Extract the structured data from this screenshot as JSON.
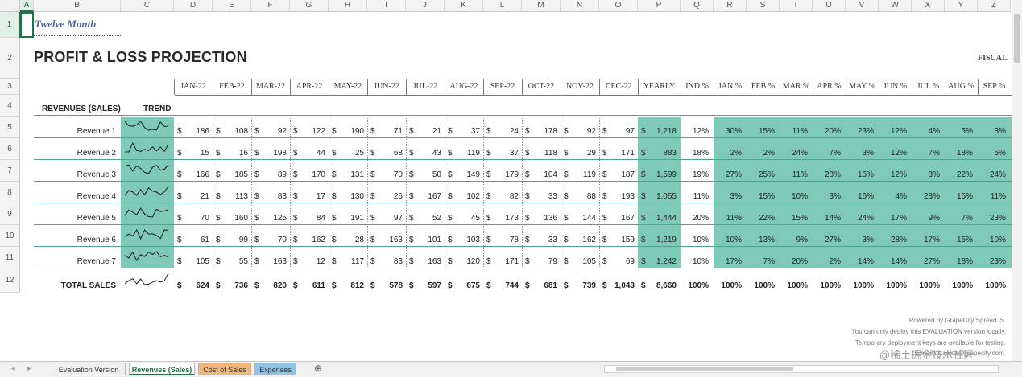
{
  "columns": [
    "A",
    "B",
    "C",
    "D",
    "E",
    "F",
    "G",
    "H",
    "I",
    "J",
    "K",
    "L",
    "M",
    "N",
    "O",
    "P",
    "Q",
    "R",
    "S",
    "T",
    "U",
    "V",
    "W",
    "X",
    "Y",
    "Z"
  ],
  "rows": [
    "1",
    "2",
    "3",
    "4",
    "5",
    "6",
    "7",
    "8",
    "9",
    "10",
    "11",
    "12"
  ],
  "sheet": {
    "title1": "Twelve Month",
    "title2": "PROFIT & LOSS PROJECTION",
    "fiscal": "FISCAL",
    "months": [
      "JAN-22",
      "FEB-22",
      "MAR-22",
      "APR-22",
      "MAY-22",
      "JUN-22",
      "JUL-22",
      "AUG-22",
      "SEP-22",
      "OCT-22",
      "NOV-22",
      "DEC-22"
    ],
    "yearly_label": "YEARLY",
    "pct_labels": [
      "IND %",
      "JAN %",
      "FEB %",
      "MAR %",
      "APR %",
      "MAY %",
      "JUN %",
      "JUL %",
      "AUG %",
      "SEP %"
    ],
    "section_label": "REVENUES (SALES)",
    "trend_label": "TREND",
    "currency": "$",
    "revenues": [
      {
        "name": "Revenue 1",
        "values": [
          "186",
          "108",
          "92",
          "122",
          "190",
          "71",
          "21",
          "37",
          "24",
          "178",
          "92",
          "97"
        ],
        "yearly": "1,218",
        "pcts": [
          "12%",
          "30%",
          "15%",
          "11%",
          "20%",
          "23%",
          "12%",
          "4%",
          "5%",
          "3%"
        ]
      },
      {
        "name": "Revenue 2",
        "values": [
          "15",
          "16",
          "198",
          "44",
          "25",
          "68",
          "43",
          "119",
          "37",
          "118",
          "29",
          "171"
        ],
        "yearly": "883",
        "pcts": [
          "18%",
          "2%",
          "2%",
          "24%",
          "7%",
          "3%",
          "12%",
          "7%",
          "18%",
          "5%"
        ]
      },
      {
        "name": "Revenue 3",
        "values": [
          "166",
          "185",
          "89",
          "170",
          "131",
          "70",
          "50",
          "149",
          "179",
          "104",
          "119",
          "187"
        ],
        "yearly": "1,599",
        "pcts": [
          "19%",
          "27%",
          "25%",
          "11%",
          "28%",
          "16%",
          "12%",
          "8%",
          "22%",
          "24%"
        ]
      },
      {
        "name": "Revenue 4",
        "values": [
          "21",
          "113",
          "83",
          "17",
          "130",
          "26",
          "167",
          "102",
          "82",
          "33",
          "88",
          "193"
        ],
        "yearly": "1,055",
        "pcts": [
          "11%",
          "3%",
          "15%",
          "10%",
          "3%",
          "16%",
          "4%",
          "28%",
          "15%",
          "11%"
        ]
      },
      {
        "name": "Revenue 5",
        "values": [
          "70",
          "160",
          "125",
          "84",
          "191",
          "97",
          "52",
          "45",
          "173",
          "136",
          "144",
          "167"
        ],
        "yearly": "1,444",
        "pcts": [
          "20%",
          "11%",
          "22%",
          "15%",
          "14%",
          "24%",
          "17%",
          "9%",
          "7%",
          "23%"
        ]
      },
      {
        "name": "Revenue 6",
        "values": [
          "61",
          "99",
          "70",
          "162",
          "28",
          "163",
          "101",
          "103",
          "78",
          "33",
          "162",
          "159"
        ],
        "yearly": "1,219",
        "pcts": [
          "10%",
          "10%",
          "13%",
          "9%",
          "27%",
          "3%",
          "28%",
          "17%",
          "15%",
          "10%"
        ]
      },
      {
        "name": "Revenue 7",
        "values": [
          "105",
          "55",
          "163",
          "12",
          "117",
          "83",
          "163",
          "120",
          "171",
          "79",
          "105",
          "69"
        ],
        "yearly": "1,242",
        "pcts": [
          "10%",
          "17%",
          "7%",
          "20%",
          "2%",
          "14%",
          "14%",
          "27%",
          "18%",
          "23%"
        ]
      }
    ],
    "total": {
      "name": "TOTAL SALES",
      "values": [
        "624",
        "736",
        "820",
        "611",
        "812",
        "578",
        "597",
        "675",
        "744",
        "681",
        "739",
        "1,043"
      ],
      "yearly": "8,660",
      "pcts": [
        "100%",
        "100%",
        "100%",
        "100%",
        "100%",
        "100%",
        "100%",
        "100%",
        "100%",
        "100%"
      ]
    }
  },
  "watermark": {
    "line1": "Powered by GrapeCity SpreadJS.",
    "line2": "You can only deploy this EVALUATION version locally.",
    "line3": "Temporary deployment keys are available for testing.",
    "line4": "Email us.sales@grapecity.com.",
    "overlay": "@稀土掘金技术社区"
  },
  "tabs": [
    {
      "label": "Evaluation Version",
      "color": "#f0f0f0",
      "active": false
    },
    {
      "label": "Revenues (Sales)",
      "color": "#ffffff",
      "active": true
    },
    {
      "label": "Cost of Sales",
      "color": "#f0b67a",
      "active": false
    },
    {
      "label": "Expenses",
      "color": "#8fc3e6",
      "active": false
    }
  ],
  "nav": {
    "prev": "◂",
    "next": "▸",
    "add": "⊕"
  },
  "colors": {
    "accent": "#217346",
    "teal": "#7ecab6",
    "title_blue": "#4e64a8"
  }
}
